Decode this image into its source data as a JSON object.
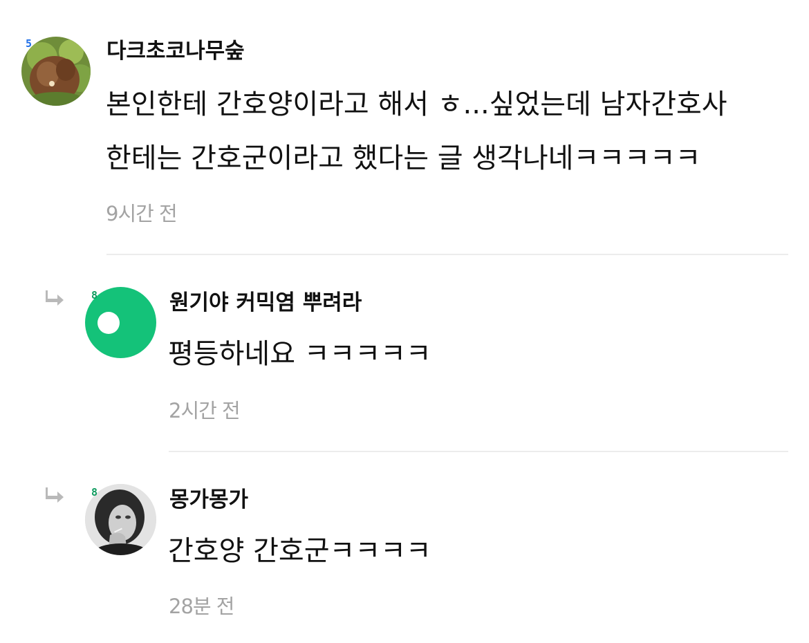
{
  "colors": {
    "text": "#111111",
    "time": "#a3a3a3",
    "divider": "#ececec",
    "level_blue": "#1f6fe8",
    "level_green": "#0f9b5f",
    "avatar_green": "#14c279",
    "reply_arrow": "#b9b9b9"
  },
  "comments": [
    {
      "author": "다크초코나무숲",
      "level": "5",
      "content_lines": [
        "본인한테 간호양이라고 해서 ㅎ...싶었는데 남자간호사",
        "한테는 간호군이라고 했다는 글 생각나네ㅋㅋㅋㅋㅋ"
      ],
      "time": "9시간 전",
      "avatar_icon": "forest-avatar"
    },
    {
      "author": "원기야 커믹염 뿌려라",
      "level": "8",
      "content_lines": [
        "평등하네요 ㅋㅋㅋㅋㅋ"
      ],
      "time": "2시간 전",
      "avatar_icon": "green-default-avatar",
      "is_reply": true
    },
    {
      "author": "몽가몽가",
      "level": "8",
      "content_lines": [
        "간호양 간호군ㅋㅋㅋㅋ"
      ],
      "time": "28분 전",
      "avatar_icon": "photo-avatar",
      "is_reply": true
    }
  ]
}
